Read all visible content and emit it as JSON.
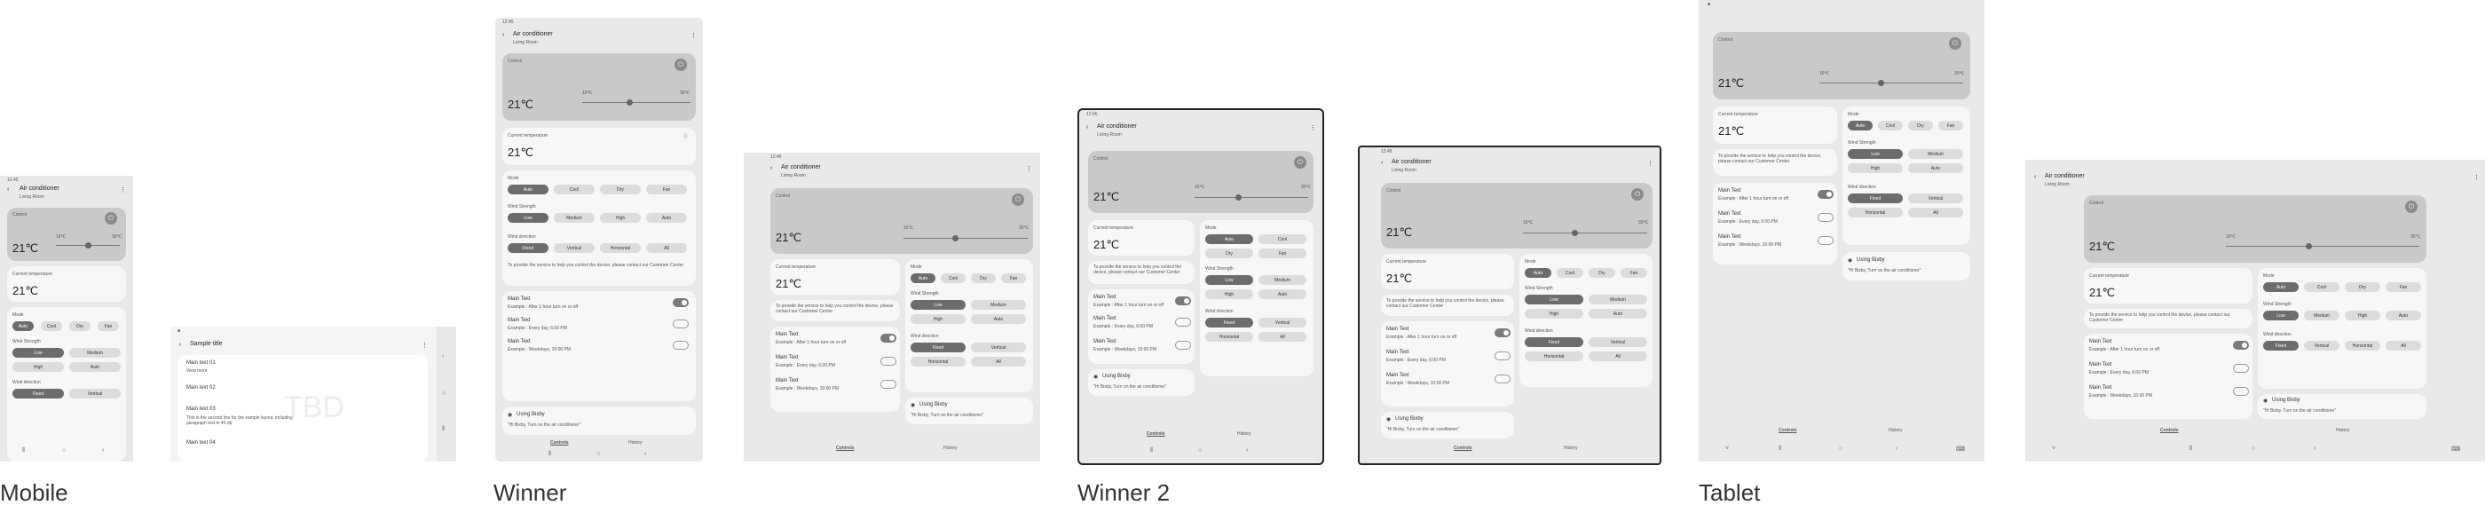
{
  "devices": {
    "mobile": "Mobile",
    "winner": "Winner",
    "winner2": "Winner 2",
    "tablet": "Tablet"
  },
  "app": {
    "title": "Air conditioner",
    "subtitle": "Living Room",
    "control_title": "Control",
    "temp": "21℃",
    "min_temp": "16℃",
    "max_temp": "30℃",
    "current_temp_label": "Current temperature",
    "mode_label": "Mode",
    "modes": [
      "Auto",
      "Cool",
      "Dry",
      "Fan"
    ],
    "wind_strength_label": "Wind Strength",
    "wind_strengths": [
      "Low",
      "Medium",
      "High",
      "Auto"
    ],
    "wind_direction_label": "Wind direction",
    "wind_directions": [
      "Fixed",
      "Vertical",
      "Horizontal",
      "All"
    ],
    "info_text": "To provide the service to help you control the device, please contact our Customer Center",
    "main_text_1": "Main Text",
    "sub_text_1": "Example : After 1 hour turn on or off",
    "main_text_2": "Main Text",
    "sub_text_2": "Example : Every day, 6:00 PM",
    "main_text_3": "Main Text",
    "sub_text_3": "Example : Weekdays, 10:00 PM",
    "bixby_title": "Using Bixby",
    "bixby_hint": "\"Hi Bixby, Turn on the air conditioner\"",
    "tab_controls": "Controls",
    "tab_history": "History",
    "status_time": "12:45"
  },
  "sample": {
    "title": "Sample title",
    "items": [
      "Main text 01",
      "Main text 02",
      "Main text 03",
      "Main text 04"
    ],
    "item1_sub": "View more",
    "item3_sub": "This is the second line for the sample layout, including paragraph text in 40 dp",
    "tbd": "TBD"
  },
  "icons": {
    "back": "back-arrow-icon",
    "more": "more-vertical-icon",
    "power": "power-icon",
    "info": "info-icon",
    "bixby": "bixby-icon"
  }
}
